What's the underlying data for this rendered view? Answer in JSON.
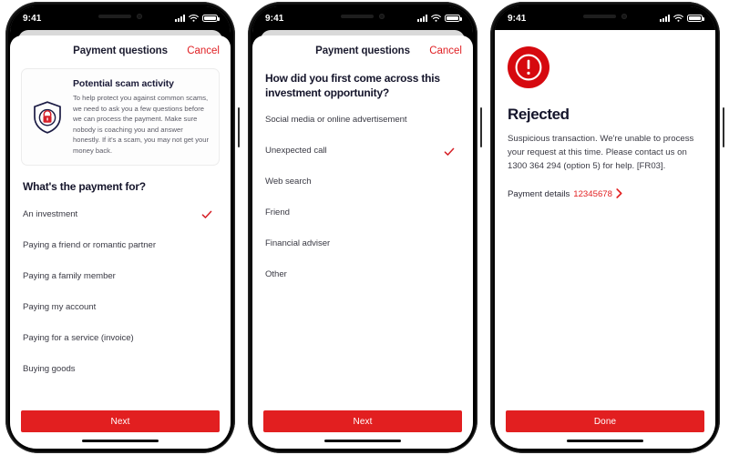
{
  "theme": {
    "brand_red": "#e21f20",
    "link_red": "#e01f23",
    "navy": "#1b1b38",
    "body_text": "#3a3a44",
    "muted_text": "#5b5b66"
  },
  "status_bar": {
    "time": "9:41",
    "signal_icon": "cellular-signal-icon",
    "wifi_icon": "wifi-icon",
    "battery_icon": "battery-full-icon"
  },
  "screens": [
    {
      "id": "payment-purpose",
      "header": {
        "title": "Payment questions",
        "cancel_label": "Cancel"
      },
      "alert_card": {
        "icon": "shield-lock-icon",
        "title": "Potential scam activity",
        "body": "To help protect you against common scams, we need to ask you a few questions before we can process the payment. Make sure nobody is coaching you and answer honestly. If it's a scam, you may not get your money back."
      },
      "question": "What's the payment for?",
      "options": [
        {
          "label": "An investment",
          "selected": true
        },
        {
          "label": "Paying a friend or romantic partner",
          "selected": false
        },
        {
          "label": "Paying a family member",
          "selected": false
        },
        {
          "label": "Paying my account",
          "selected": false
        },
        {
          "label": "Paying for a service (invoice)",
          "selected": false
        },
        {
          "label": "Buying goods",
          "selected": false
        }
      ],
      "primary_button": "Next"
    },
    {
      "id": "investment-source",
      "header": {
        "title": "Payment questions",
        "cancel_label": "Cancel"
      },
      "question": "How did you first come across this investment opportunity?",
      "options": [
        {
          "label": "Social media or online advertisement",
          "selected": false
        },
        {
          "label": "Unexpected call",
          "selected": true
        },
        {
          "label": "Web search",
          "selected": false
        },
        {
          "label": "Friend",
          "selected": false
        },
        {
          "label": "Financial adviser",
          "selected": false
        },
        {
          "label": "Other",
          "selected": false
        }
      ],
      "primary_button": "Next"
    },
    {
      "id": "rejected-result",
      "result": {
        "icon": "error-exclamation-circle-icon",
        "title": "Rejected",
        "message": "Suspicious transaction. We're unable to process your request at this time. Please contact us on 1300 364 294 (option 5) for help. [FR03].",
        "link_label": "Payment details",
        "link_value": "12345678",
        "link_chevron": "chevron-right-icon"
      },
      "primary_button": "Done"
    }
  ]
}
